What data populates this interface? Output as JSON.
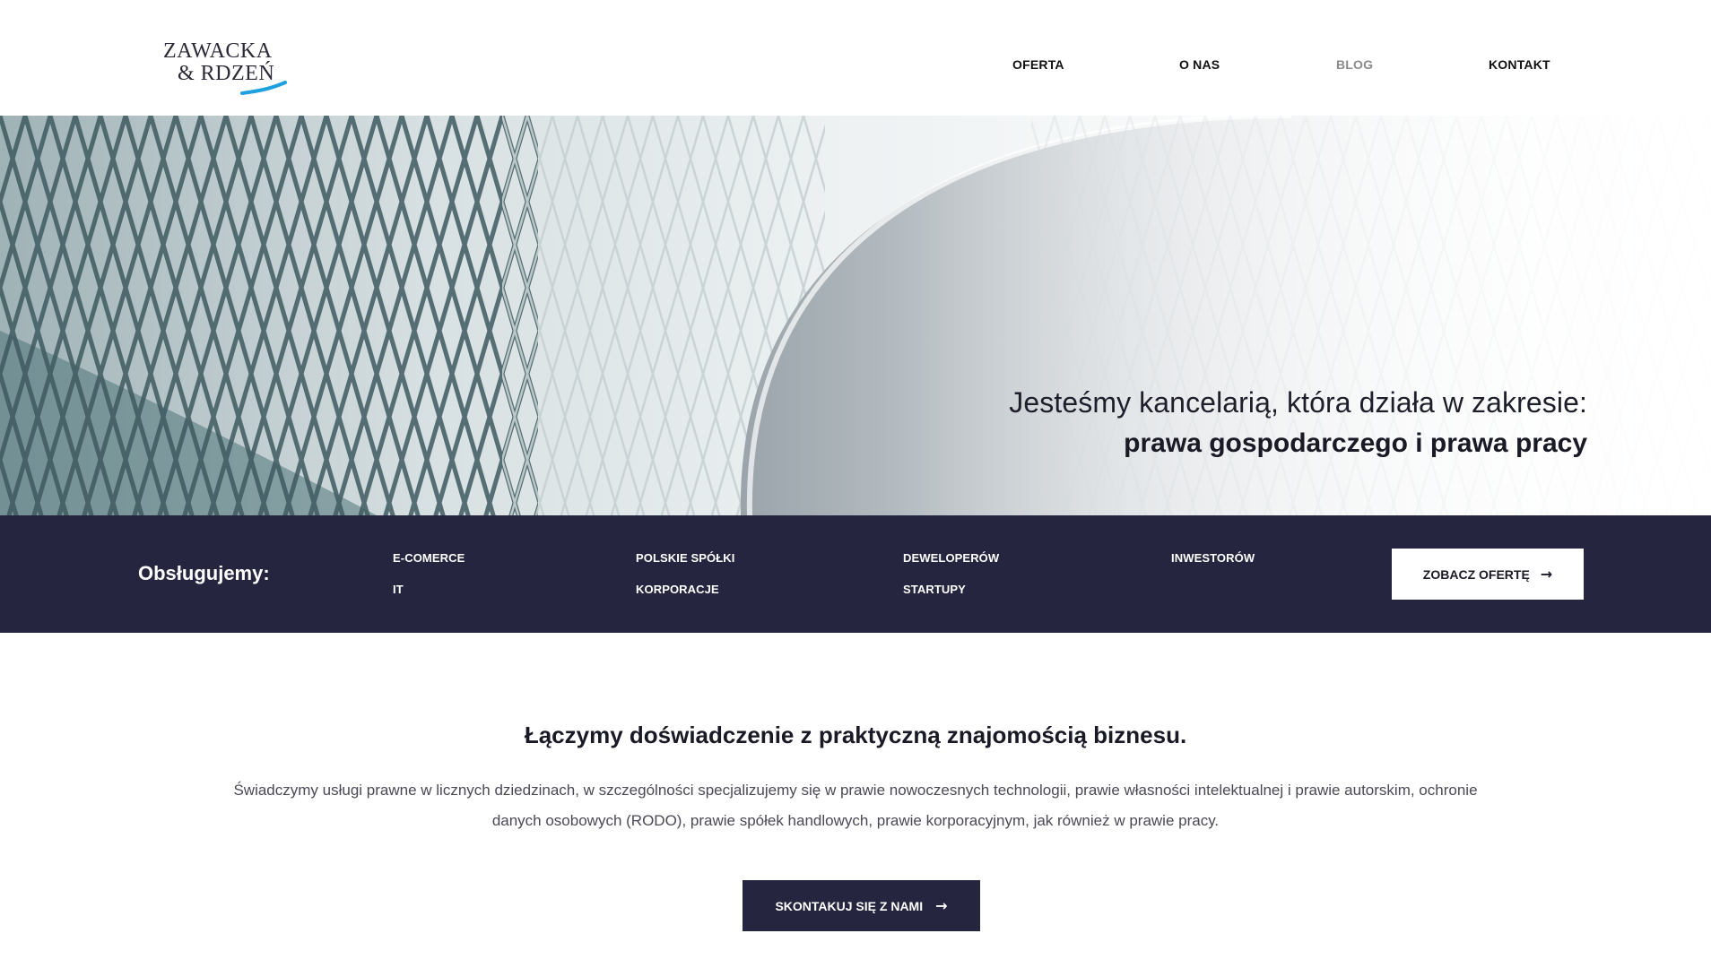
{
  "logo": {
    "line1": "ZAWACKA",
    "line2": "& RDZEŃ",
    "accent_color": "#1ea0e0"
  },
  "nav": {
    "items": [
      {
        "label": "OFERTA"
      },
      {
        "label": "O NAS"
      },
      {
        "label": "BLOG",
        "active": true
      },
      {
        "label": "KONTAKT"
      }
    ]
  },
  "hero": {
    "line1": "Jesteśmy kancelarią, która działa w zakresie:",
    "line2": "prawa gospodarczego i prawa pracy"
  },
  "clients": {
    "label": "Obsługujemy:",
    "items": [
      "E-COMERCE",
      "IT",
      "POLSKIE SPÓŁKI",
      "KORPORACJE",
      "DEWELOPERÓW",
      "STARTUPY",
      "INWESTORÓW"
    ],
    "button_label": "ZOBACZ OFERTĘ",
    "button_icon": "arrow-right-icon"
  },
  "about": {
    "title": "Łączymy doświadczenie z praktyczną znajomością biznesu.",
    "body": "Świadczymy usługi prawne w licznych dziedzinach, w szczególności specjalizujemy się w prawie nowoczesnych technologii, prawie własności intelektualnej i prawie autorskim, ochronie danych osobowych (RODO), prawie spółek handlowych, prawie korporacyjnym, jak również w prawie pracy.",
    "button_label": "SKONTAKUJ SIĘ Z NAMI",
    "button_icon": "arrow-right-icon"
  },
  "colors": {
    "navy": "#252540",
    "white": "#ffffff",
    "muted_nav": "#8b8b8b"
  }
}
